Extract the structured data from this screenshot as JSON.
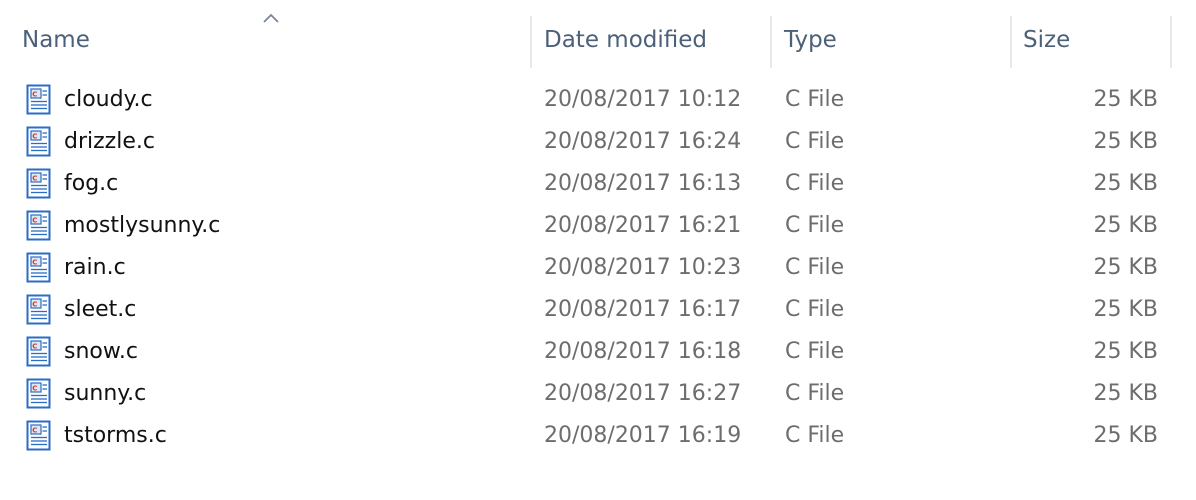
{
  "columns": {
    "name": "Name",
    "date_modified": "Date modified",
    "type": "Type",
    "size": "Size"
  },
  "sort": {
    "column": "name",
    "direction": "ascending",
    "icon": "chevron-up-icon"
  },
  "file_icon": "c-source-file-icon",
  "files": [
    {
      "name": "cloudy.c",
      "date": "20/08/2017 10:12",
      "type": "C File",
      "size": "25 KB"
    },
    {
      "name": "drizzle.c",
      "date": "20/08/2017 16:24",
      "type": "C File",
      "size": "25 KB"
    },
    {
      "name": "fog.c",
      "date": "20/08/2017 16:13",
      "type": "C File",
      "size": "25 KB"
    },
    {
      "name": "mostlysunny.c",
      "date": "20/08/2017 16:21",
      "type": "C File",
      "size": "25 KB"
    },
    {
      "name": "rain.c",
      "date": "20/08/2017 10:23",
      "type": "C File",
      "size": "25 KB"
    },
    {
      "name": "sleet.c",
      "date": "20/08/2017 16:17",
      "type": "C File",
      "size": "25 KB"
    },
    {
      "name": "snow.c",
      "date": "20/08/2017 16:18",
      "type": "C File",
      "size": "25 KB"
    },
    {
      "name": "sunny.c",
      "date": "20/08/2017 16:27",
      "type": "C File",
      "size": "25 KB"
    },
    {
      "name": "tstorms.c",
      "date": "20/08/2017 16:19",
      "type": "C File",
      "size": "25 KB"
    }
  ],
  "colors": {
    "header_text": "#4c607a",
    "name_text": "#111111",
    "detail_text": "#6d6d6d",
    "separator": "#e6e8ec",
    "icon_blue": "#2b6cc4"
  }
}
